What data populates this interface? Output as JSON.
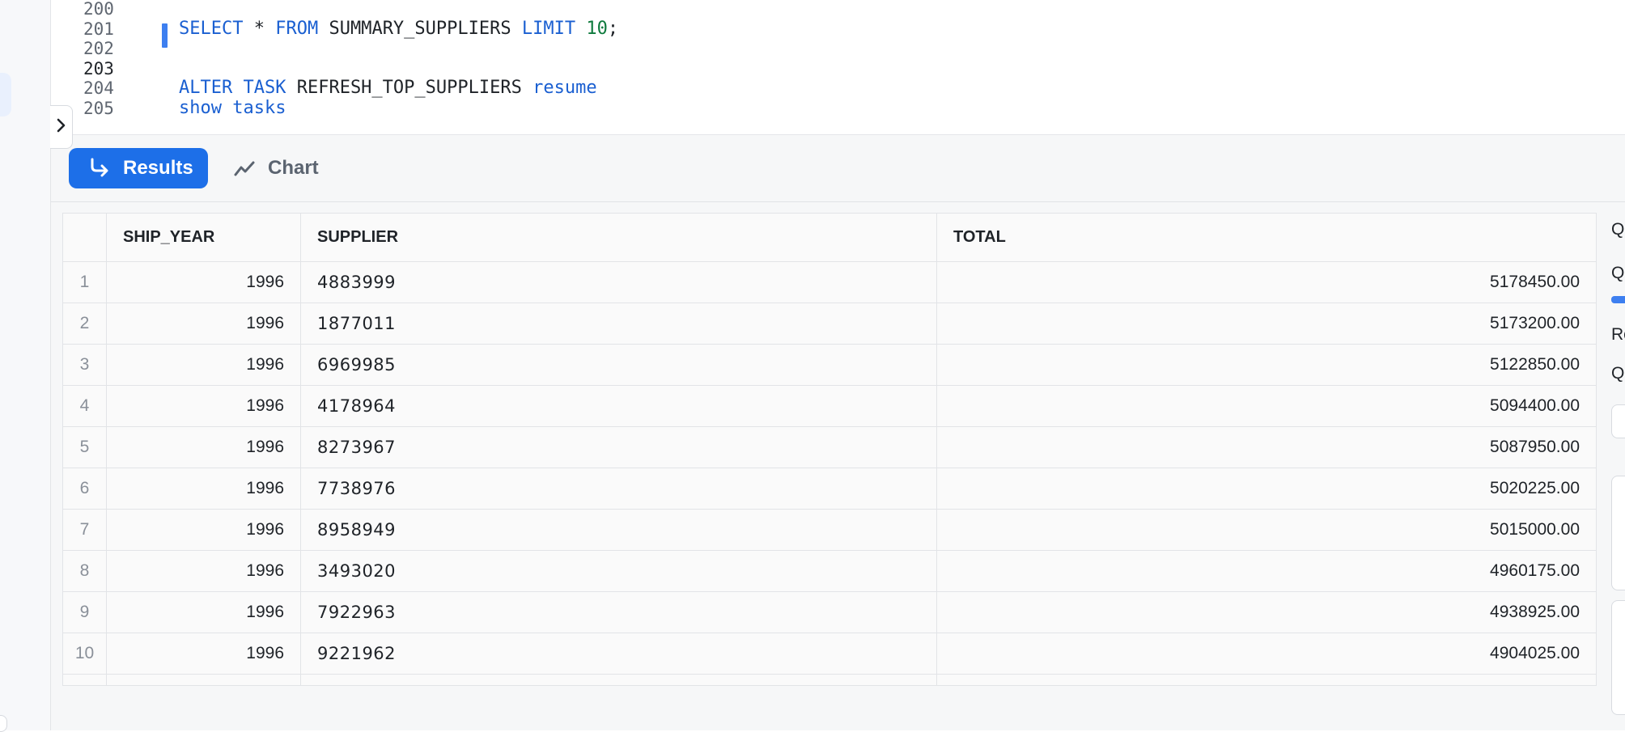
{
  "editor": {
    "lines": [
      {
        "num": "200",
        "segments": []
      },
      {
        "num": "201",
        "segments": [
          {
            "t": "SELECT",
            "c": "kw"
          },
          {
            "t": " * ",
            "c": ""
          },
          {
            "t": "FROM",
            "c": "kw"
          },
          {
            "t": " SUMMARY_SUPPLIERS ",
            "c": ""
          },
          {
            "t": "LIMIT",
            "c": "kw"
          },
          {
            "t": " ",
            "c": ""
          },
          {
            "t": "10",
            "c": "num"
          },
          {
            "t": ";",
            "c": ""
          }
        ]
      },
      {
        "num": "202",
        "segments": []
      },
      {
        "num": "203",
        "segments": []
      },
      {
        "num": "204",
        "segments": [
          {
            "t": "ALTER",
            "c": "kw"
          },
          {
            "t": " ",
            "c": ""
          },
          {
            "t": "TASK",
            "c": "kw"
          },
          {
            "t": " REFRESH_TOP_SUPPLIERS ",
            "c": ""
          },
          {
            "t": "resume",
            "c": "kw"
          }
        ]
      },
      {
        "num": "205",
        "segments": [
          {
            "t": "show",
            "c": "kw"
          },
          {
            "t": " ",
            "c": ""
          },
          {
            "t": "tasks",
            "c": "kw"
          }
        ]
      }
    ],
    "active_line": "203",
    "collapse_icon": "chevron-right-icon"
  },
  "tabs": {
    "results_label": "Results",
    "results_icon": "arrow-turn-right-icon",
    "chart_label": "Chart",
    "chart_icon": "line-chart-icon"
  },
  "table": {
    "columns": [
      "",
      "SHIP_YEAR",
      "SUPPLIER",
      "TOTAL"
    ],
    "rows": [
      [
        "1",
        "1996",
        "4883999",
        "5178450.00"
      ],
      [
        "2",
        "1996",
        "1877011",
        "5173200.00"
      ],
      [
        "3",
        "1996",
        "6969985",
        "5122850.00"
      ],
      [
        "4",
        "1996",
        "4178964",
        "5094400.00"
      ],
      [
        "5",
        "1996",
        "8273967",
        "5087950.00"
      ],
      [
        "6",
        "1996",
        "7738976",
        "5020225.00"
      ],
      [
        "7",
        "1996",
        "8958949",
        "5015000.00"
      ],
      [
        "8",
        "1996",
        "3493020",
        "4960175.00"
      ],
      [
        "9",
        "1996",
        "7922963",
        "4938925.00"
      ],
      [
        "10",
        "1996",
        "9221962",
        "4904025.00"
      ]
    ]
  },
  "side_panel": {
    "labels": [
      "Q",
      "Q",
      "Ro",
      "Q"
    ]
  },
  "colors": {
    "accent": "#1d6fe8",
    "keyword": "#1a5fd1",
    "number": "#0e7a3d"
  }
}
